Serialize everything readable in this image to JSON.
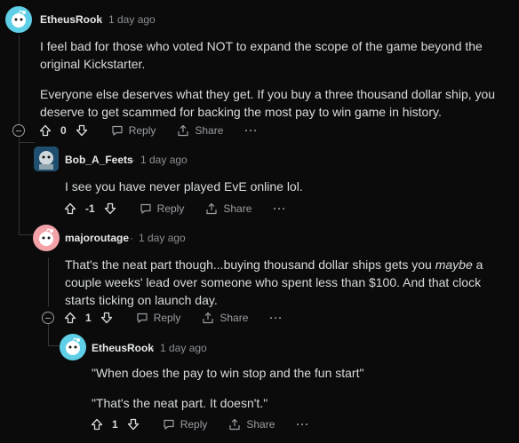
{
  "comments": [
    {
      "username": "EthеusRook",
      "time": "1 day ago",
      "paragraphs": [
        "I feel bad for those who voted NOT to expand the scope of the game beyond the original Kickstarter.",
        "Everyone else deserves what they get. If you buy a three thousand dollar ship, you deserve to get scammed for backing the most pay to win game in history."
      ],
      "score": "0",
      "reply_label": "Reply",
      "share_label": "Share",
      "more_label": "···"
    },
    {
      "username": "Bob_A_Feets",
      "time": "1 day ago",
      "paragraphs": [
        "I see you have never played EvE online lol."
      ],
      "score": "-1",
      "reply_label": "Reply",
      "share_label": "Share",
      "more_label": "···"
    },
    {
      "username": "majoroutage",
      "time": "1 day ago",
      "paragraph_parts": {
        "before": "That's the neat part though...buying thousand dollar ships gets you ",
        "emphasis": "maybe",
        "after": " a couple weeks' lead over someone who spent less than $100. And that clock starts ticking on launch day."
      },
      "score": "1",
      "reply_label": "Reply",
      "share_label": "Share",
      "more_label": "···"
    },
    {
      "username": "EtheusRook",
      "time": "1 day ago",
      "paragraphs": [
        "\"When does the pay to win stop and the fun start\"",
        "\"That's the neat part. It doesn't.\""
      ],
      "score": "1",
      "reply_label": "Reply",
      "share_label": "Share",
      "more_label": "···"
    }
  ],
  "colors": {
    "background": "#0b0b0b",
    "text": "#d7dadc",
    "muted": "#8b8f94",
    "thread_line": "#343536",
    "avatar_teal": "#5ecfe6",
    "avatar_pink": "#f2a2a8"
  },
  "icons": [
    "upvote-icon",
    "downvote-icon",
    "reply-icon",
    "share-icon",
    "more-icon",
    "collapse-icon"
  ]
}
